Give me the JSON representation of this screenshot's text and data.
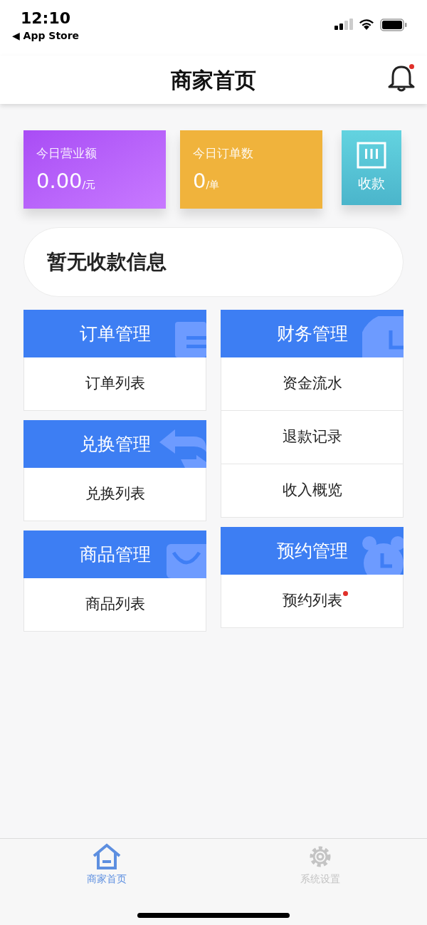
{
  "status_bar": {
    "time": "12:10",
    "back_label": "◀ App Store"
  },
  "header": {
    "title": "商家首页",
    "notification_badge": true
  },
  "stats": [
    {
      "kind": "revenue",
      "label": "今日营业额",
      "value": "0.00",
      "unit": "/元"
    },
    {
      "kind": "orders",
      "label": "今日订单数",
      "value": "0",
      "unit": "/单"
    }
  ],
  "collect_button": {
    "label": "收款"
  },
  "notice": "暂无收款信息",
  "columns": [
    [
      {
        "title": "订单管理",
        "kind": "list",
        "items": [
          {
            "label": "订单列表",
            "badge": false
          }
        ]
      },
      {
        "title": "兑换管理",
        "kind": "exchange",
        "items": [
          {
            "label": "兑换列表",
            "badge": false
          }
        ]
      },
      {
        "title": "商品管理",
        "kind": "bag",
        "items": [
          {
            "label": "商品列表",
            "badge": false
          }
        ]
      }
    ],
    [
      {
        "title": "财务管理",
        "kind": "pie",
        "items": [
          {
            "label": "资金流水",
            "badge": false
          },
          {
            "label": "退款记录",
            "badge": false
          },
          {
            "label": "收入概览",
            "badge": false
          }
        ]
      },
      {
        "title": "预约管理",
        "kind": "clock",
        "items": [
          {
            "label": "预约列表",
            "badge": true
          }
        ]
      }
    ]
  ],
  "tabs": [
    {
      "label": "商家首页",
      "kind": "home",
      "selected": true
    },
    {
      "label": "系统设置",
      "kind": "settings",
      "selected": false
    }
  ]
}
